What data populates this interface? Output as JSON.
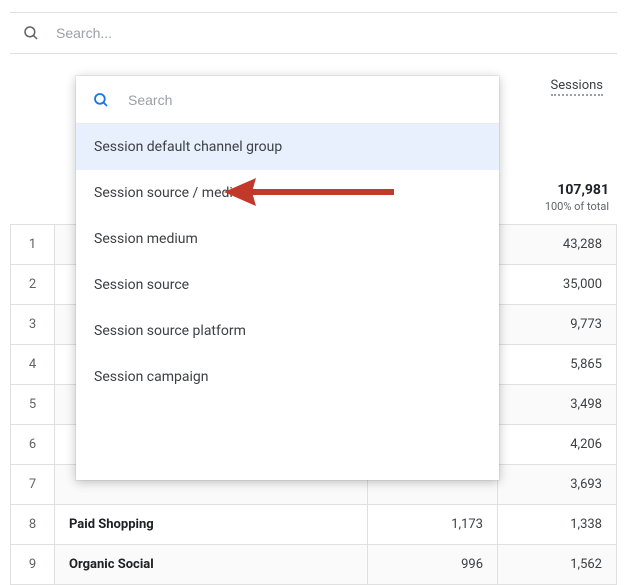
{
  "top_search": {
    "placeholder": "Search..."
  },
  "sessions_header": "Sessions",
  "totals": {
    "value": "107,981",
    "sub": "100% of total"
  },
  "dropdown": {
    "search_placeholder": "Search",
    "items": [
      {
        "label": "Session default channel group"
      },
      {
        "label": "Session source / medium"
      },
      {
        "label": "Session medium"
      },
      {
        "label": "Session source"
      },
      {
        "label": "Session source platform"
      },
      {
        "label": "Session campaign"
      }
    ]
  },
  "rows": [
    {
      "idx": "1",
      "name": "",
      "mid": "",
      "sessions": "43,288"
    },
    {
      "idx": "2",
      "name": "",
      "mid": "",
      "sessions": "35,000"
    },
    {
      "idx": "3",
      "name": "",
      "mid": "",
      "sessions": "9,773"
    },
    {
      "idx": "4",
      "name": "",
      "mid": "",
      "sessions": "5,865"
    },
    {
      "idx": "5",
      "name": "",
      "mid": "",
      "sessions": "3,498"
    },
    {
      "idx": "6",
      "name": "",
      "mid": "",
      "sessions": "4,206"
    },
    {
      "idx": "7",
      "name": "",
      "mid": "",
      "sessions": "3,693"
    },
    {
      "idx": "8",
      "name": "Paid Shopping",
      "mid": "1,173",
      "sessions": "1,338"
    },
    {
      "idx": "9",
      "name": "Organic Social",
      "mid": "996",
      "sessions": "1,562"
    }
  ],
  "arrow_color": "#c0392b"
}
